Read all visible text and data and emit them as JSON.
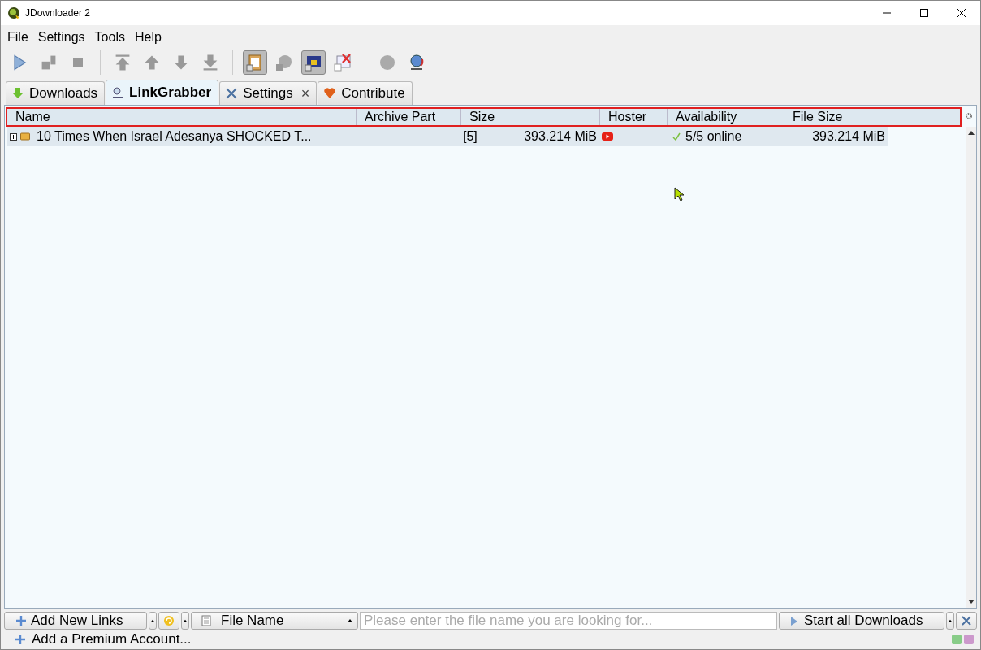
{
  "window": {
    "title": "JDownloader 2"
  },
  "menu": [
    "File",
    "Settings",
    "Tools",
    "Help"
  ],
  "tabs": [
    {
      "label": "Downloads",
      "selected": false
    },
    {
      "label": "LinkGrabber",
      "selected": true
    },
    {
      "label": "Settings",
      "selected": false,
      "close": "×"
    },
    {
      "label": "Contribute",
      "selected": false
    }
  ],
  "table": {
    "columns": [
      "Name",
      "Archive Part",
      "Size",
      "Hoster",
      "Availability",
      "File Size"
    ],
    "rows": [
      {
        "expanded": false,
        "name": "10 Times When Israel Adesanya SHOCKED T...",
        "count": "[5]",
        "size": "393.214 MiB",
        "availability": "5/5 online",
        "file_size": "393.214 MiB"
      }
    ]
  },
  "bottom_bar": {
    "add_links": "Add New Links",
    "filter": "File Name",
    "search": {
      "placeholder": "Please enter the file name you are looking for..."
    },
    "start": "Start all Downloads"
  },
  "status_bar": {
    "premium": "Add a Premium Account..."
  }
}
